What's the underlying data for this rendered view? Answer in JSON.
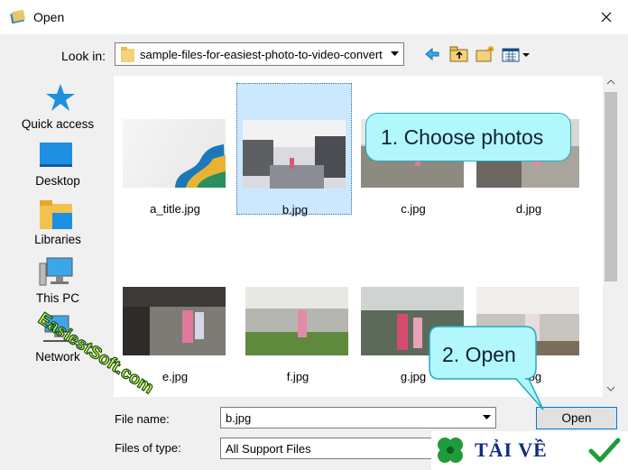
{
  "window": {
    "title": "Open"
  },
  "toolbar": {
    "lookin_label": "Look in:",
    "lookin_value": "sample-files-for-easiest-photo-to-video-convert"
  },
  "places": [
    {
      "label": "Quick access"
    },
    {
      "label": "Desktop"
    },
    {
      "label": "Libraries"
    },
    {
      "label": "This PC"
    },
    {
      "label": "Network"
    }
  ],
  "files": [
    {
      "name": "a_title.jpg"
    },
    {
      "name": "b.jpg"
    },
    {
      "name": "c.jpg"
    },
    {
      "name": "d.jpg"
    },
    {
      "name": "e.jpg"
    },
    {
      "name": "f.jpg"
    },
    {
      "name": "g.jpg"
    },
    {
      "name": "h.jpg"
    }
  ],
  "bottom": {
    "filename_label": "File name:",
    "filename_value": "b.jpg",
    "filetype_label": "Files of type:",
    "filetype_value": "All Support Files",
    "open_button": "Open"
  },
  "annotations": {
    "callout1": "1. Choose photos",
    "callout2": "2. Open",
    "watermark": "EasiestSoft.com",
    "brand": "TẢI VỀ"
  },
  "colors": {
    "selection": "#cce8ff",
    "callout_fill": "#b1f7fb",
    "accent": "#0078d7"
  }
}
